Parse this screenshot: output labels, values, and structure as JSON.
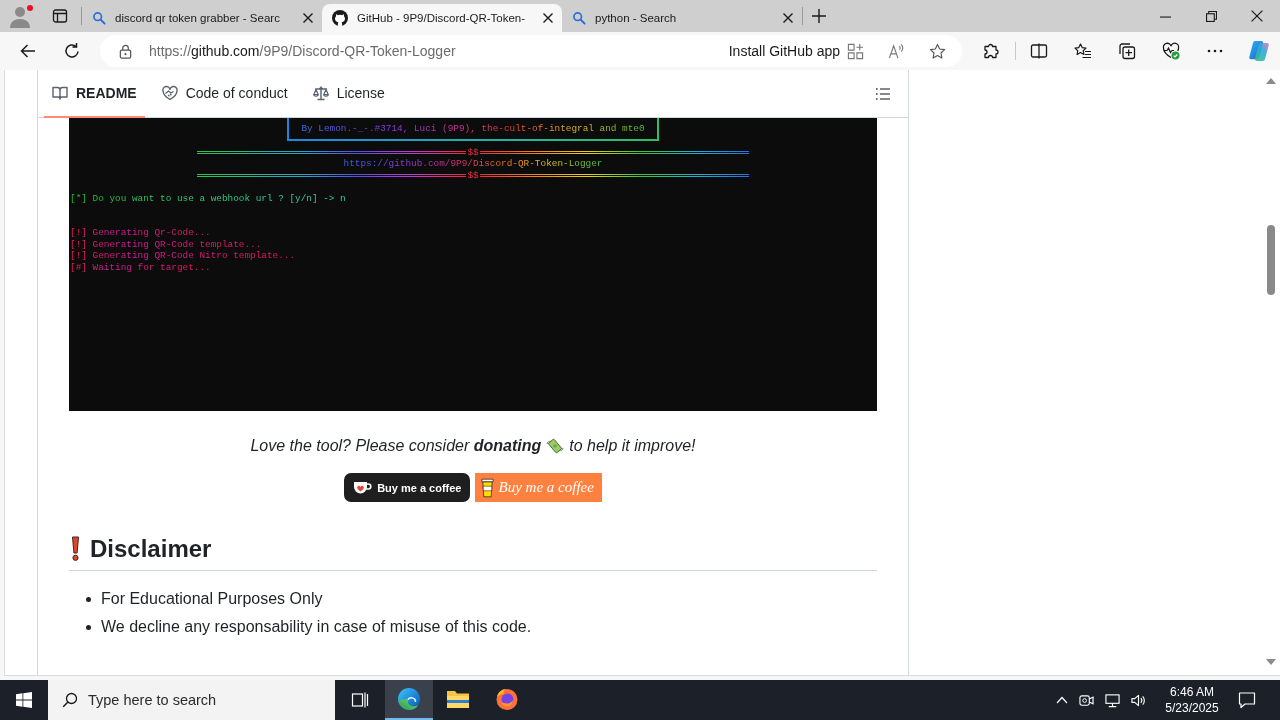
{
  "browser": {
    "tabs": [
      {
        "kind": "search",
        "title": "discord qr token grabber - Searc",
        "selected": false
      },
      {
        "kind": "site",
        "title": "GitHub - 9P9/Discord-QR-Token-",
        "selected": true
      },
      {
        "kind": "search",
        "title": "python - Search",
        "selected": false
      }
    ],
    "address_bar": {
      "url_scheme": "https://",
      "url_host": "github.com",
      "url_path": "/9P9/Discord-QR-Token-Logger",
      "install_app": "Install GitHub app"
    }
  },
  "readme": {
    "tabs": [
      {
        "kind": "book",
        "label": "README",
        "selected": true
      },
      {
        "kind": "conduct",
        "label": "Code of conduct",
        "selected": false
      },
      {
        "kind": "license",
        "label": "License",
        "selected": false
      }
    ],
    "terminal": {
      "lines": [
        {
          "kind": "banner",
          "text": "By Lemon.-_-.#3714, Luci (9P9), the-cult-of-integral and mte0"
        },
        {
          "kind": "rule",
          "text": "$$"
        },
        {
          "kind": "link",
          "text": "https://github.com/9P9/Discord-QR-Token-Logger"
        },
        {
          "kind": "rule",
          "text": "$$"
        },
        {
          "kind": "gap"
        },
        {
          "kind": "prompt",
          "text": "[*] Do you want to use a webhook url ? [y/n] -> n"
        },
        {
          "kind": "gap"
        },
        {
          "kind": "gap"
        },
        {
          "kind": "status",
          "text": "[!] Generating Qr-Code..."
        },
        {
          "kind": "status",
          "text": "[!] Generating QR-Code template..."
        },
        {
          "kind": "status",
          "text": "[!] Generating QR-Code Nitro template..."
        },
        {
          "kind": "status",
          "text": "[#] Waiting for target..."
        }
      ]
    },
    "donation": {
      "text_before": "Love the tool? Please consider **donating**",
      "text_after": "to help it improve!",
      "buttons": [
        {
          "kind": "dark",
          "label": "Buy me a coffee"
        },
        {
          "kind": "orange",
          "label": "Buy me a coffee"
        }
      ]
    },
    "disclaimer": {
      "heading": "Disclaimer",
      "items": [
        "For Educational Purposes Only",
        "We decline any responsability in case of misuse of this code."
      ]
    }
  },
  "taskbar": {
    "search": {
      "placeholder": "Type here to search"
    },
    "apps": [
      {
        "kind": "edge",
        "active": true
      },
      {
        "kind": "explorer",
        "active": false
      },
      {
        "kind": "firefox",
        "active": false
      }
    ],
    "time": "6:46 AM",
    "date": "5/23/2025"
  }
}
